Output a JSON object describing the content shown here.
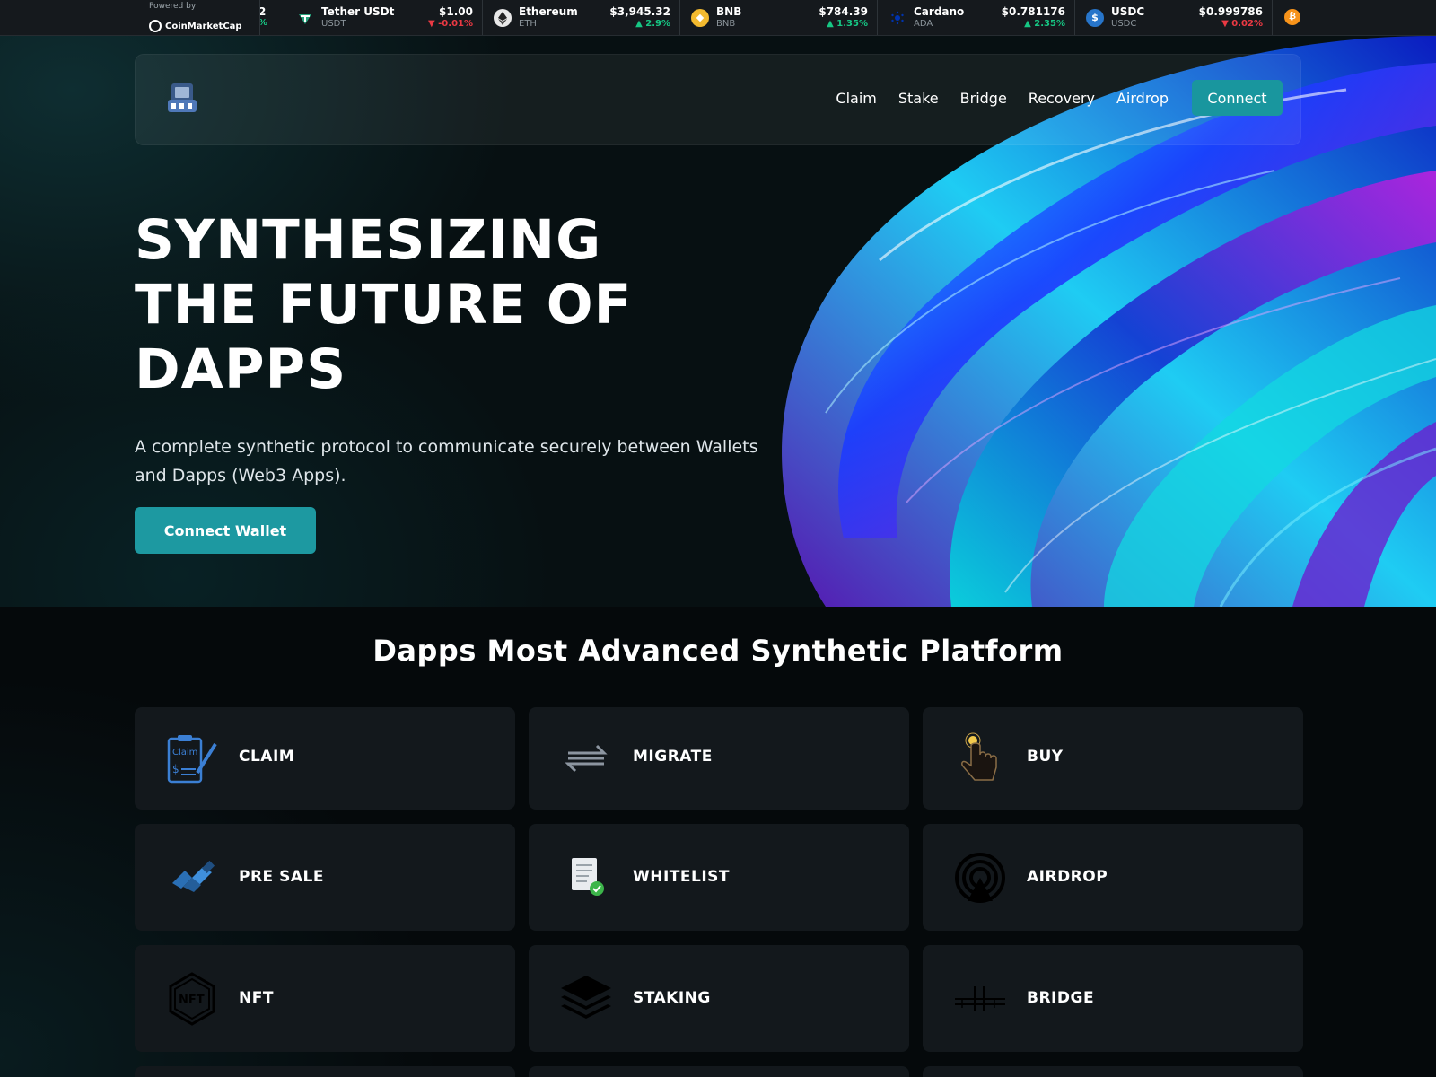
{
  "ticker": {
    "powered_by": "Powered by",
    "brand": "CoinMarketCap",
    "partial_price": "2",
    "partial_change": "%",
    "coins": [
      {
        "name": "Tether USDt",
        "symbol": "USDT",
        "price": "$1.00",
        "change": "-0.01%",
        "direction": "down",
        "icon_color": "#26a17b",
        "icon": "tether-icon"
      },
      {
        "name": "Ethereum",
        "symbol": "ETH",
        "price": "$3,945.32",
        "change": "2.9%",
        "direction": "up",
        "icon_color": "#e8e8e8",
        "icon": "ethereum-icon"
      },
      {
        "name": "BNB",
        "symbol": "BNB",
        "price": "$784.39",
        "change": "1.35%",
        "direction": "up",
        "icon_color": "#f3ba2f",
        "icon": "bnb-icon"
      },
      {
        "name": "Cardano",
        "symbol": "ADA",
        "price": "$0.781176",
        "change": "2.35%",
        "direction": "up",
        "icon_color": "#0033ad",
        "icon": "cardano-icon"
      },
      {
        "name": "USDC",
        "symbol": "USDC",
        "price": "$0.999786",
        "change": "0.02%",
        "direction": "down",
        "icon_color": "#2775ca",
        "icon": "usdc-icon"
      }
    ]
  },
  "nav": {
    "links": [
      "Claim",
      "Stake",
      "Bridge",
      "Recovery",
      "Airdrop"
    ],
    "connect": "Connect"
  },
  "hero": {
    "title_lines": [
      "SYNTHESIZING",
      "THE FUTURE OF",
      "DAPPS"
    ],
    "subtitle": "A complete synthetic protocol to communicate securely between Wallets and Dapps (Web3 Apps).",
    "button": "Connect Wallet"
  },
  "section": {
    "title": "Dapps Most Advanced Synthetic Platform",
    "cards": [
      {
        "label": "CLAIM",
        "icon": "claim-icon"
      },
      {
        "label": "MIGRATE",
        "icon": "migrate-icon"
      },
      {
        "label": "BUY",
        "icon": "buy-icon"
      },
      {
        "label": "PRE SALE",
        "icon": "presale-icon"
      },
      {
        "label": "WHITELIST",
        "icon": "whitelist-icon"
      },
      {
        "label": "AIRDROP",
        "icon": "airdrop-icon"
      },
      {
        "label": "NFT",
        "icon": "nft-icon"
      },
      {
        "label": "STAKING",
        "icon": "staking-icon"
      },
      {
        "label": "BRIDGE",
        "icon": "bridge-icon"
      }
    ]
  },
  "colors": {
    "accent": "#19969e",
    "up": "#16c784",
    "down": "#ea3943",
    "card": "#13181c"
  }
}
